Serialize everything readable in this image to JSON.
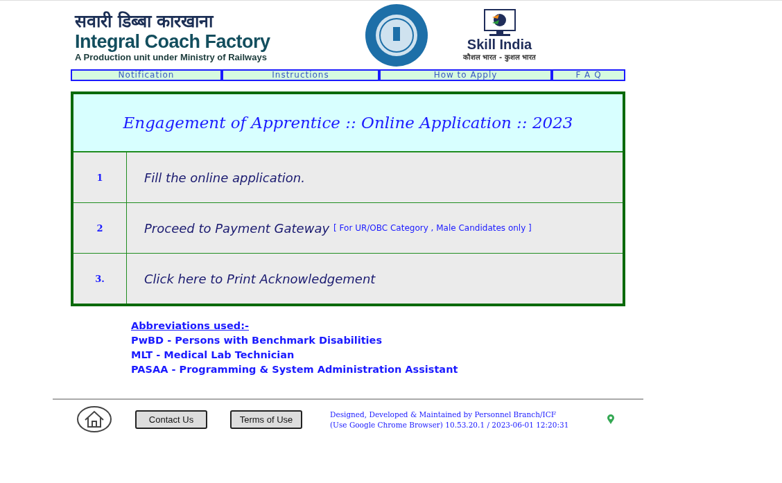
{
  "header": {
    "hindi_title": "सवारी डिब्बा कारखाना",
    "title": "Integral Coach Factory",
    "subtitle": "A Production unit under Ministry of Railways",
    "skill_logo": {
      "name": "Skill India",
      "tagline": "कौशल भारत - कुशल भारत"
    }
  },
  "nav": [
    {
      "label": "Notification"
    },
    {
      "label": "Instructions"
    },
    {
      "label": "How to Apply"
    },
    {
      "label": "F A Q"
    }
  ],
  "panel": {
    "title": "Engagement of Apprentice :: Online Application :: 2023",
    "steps": [
      {
        "number": "1",
        "text": "Fill the online application."
      },
      {
        "number": "2",
        "text": "Proceed to Payment Gateway",
        "note": "[ For UR/OBC Category , Male Candidates only ]"
      },
      {
        "number": "3.",
        "text": "Click here to Print Acknowledgement"
      }
    ]
  },
  "abbreviations": {
    "heading": "Abbreviations used:-",
    "items": [
      "PwBD - Persons with Benchmark Disabilities",
      "MLT - Medical Lab Technician",
      "PASAA - Programming & System Administration Assistant"
    ]
  },
  "footer": {
    "buttons": [
      "Contact Us",
      "Terms of Use"
    ],
    "credits": "Designed, Developed & Maintained by Personnel Branch/ICF",
    "info": "(Use Google Chrome Browser) 10.53.20.1 / 2023-06-01 12:20:31"
  }
}
